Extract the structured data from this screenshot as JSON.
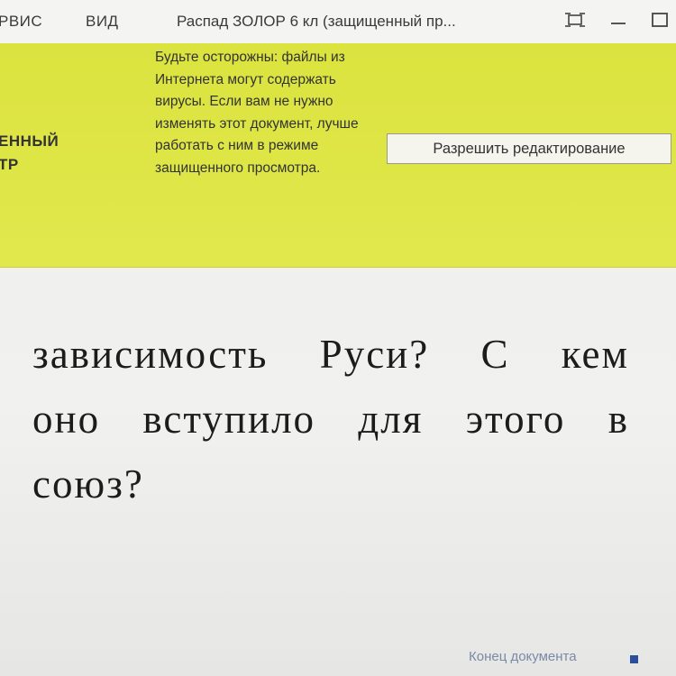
{
  "titlebar": {
    "menu_service": "РВИС",
    "menu_view": "ВИД",
    "doc_title": "Распад ЗОЛОР 6 кл (защищенный пр...",
    "icons": [
      "display-mode-icon",
      "minimize-icon",
      "maximize-icon"
    ]
  },
  "protected_view": {
    "label_line1": "ЕННЫЙ",
    "label_line2": "ТР",
    "message": "Будьте осторожны: файлы из Интернета могут содержать вирусы. Если вам не нужно изменять этот документ, лучше работать с ним в режиме защищенного просмотра.",
    "enable_editing": "Разрешить редактирование",
    "bar_color": "#dfe64a"
  },
  "document": {
    "lines": [
      "зависимость Руси? С кем",
      "оно вступило для этого в",
      "союз?"
    ],
    "end_label": "Конец документа",
    "end_marker_color": "#2c4f9c"
  }
}
